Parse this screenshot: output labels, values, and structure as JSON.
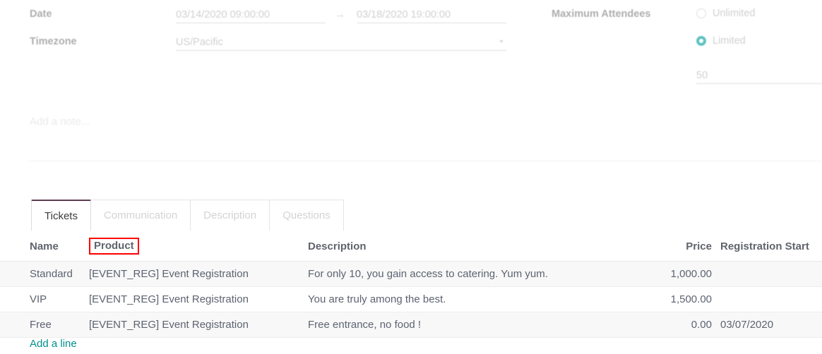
{
  "form": {
    "fields": {
      "date_label": "Date",
      "date_start": "03/14/2020 09:00:00",
      "date_arrow": "→",
      "date_end": "03/18/2020 19:00:00",
      "timezone_label": "Timezone",
      "timezone_value": "US/Pacific",
      "max_attendees_label": "Maximum Attendees",
      "max_attendees_value": "50"
    },
    "attendee_options": [
      {
        "label": "Unlimited",
        "selected": false
      },
      {
        "label": "Limited",
        "selected": true
      }
    ],
    "note_placeholder": "Add a note..."
  },
  "tabs": [
    {
      "label": "Tickets",
      "active": true
    },
    {
      "label": "Communication",
      "active": false
    },
    {
      "label": "Description",
      "active": false
    },
    {
      "label": "Questions",
      "active": false
    }
  ],
  "tickets": {
    "columns": [
      "Name",
      "Product",
      "Description",
      "Price",
      "Registration Start"
    ],
    "highlighted_column": "Product",
    "rows": [
      {
        "name": "Standard",
        "product": "[EVENT_REG] Event Registration",
        "description": "For only 10, you gain access to catering. Yum yum.",
        "price": "1,000.00",
        "registration_start": ""
      },
      {
        "name": "VIP",
        "product": "[EVENT_REG] Event Registration",
        "description": "You are truly among the best.",
        "price": "1,500.00",
        "registration_start": ""
      },
      {
        "name": "Free",
        "product": "[EVENT_REG] Event Registration",
        "description": "Free entrance, no food !",
        "price": "0.00",
        "registration_start": "03/07/2020"
      }
    ],
    "add_line_label": "Add a line"
  },
  "colors": {
    "accent_teal": "#00a09d",
    "link_teal": "#008f8c",
    "highlight_red": "#ff0000",
    "active_tab_border": "#5c3a52"
  }
}
